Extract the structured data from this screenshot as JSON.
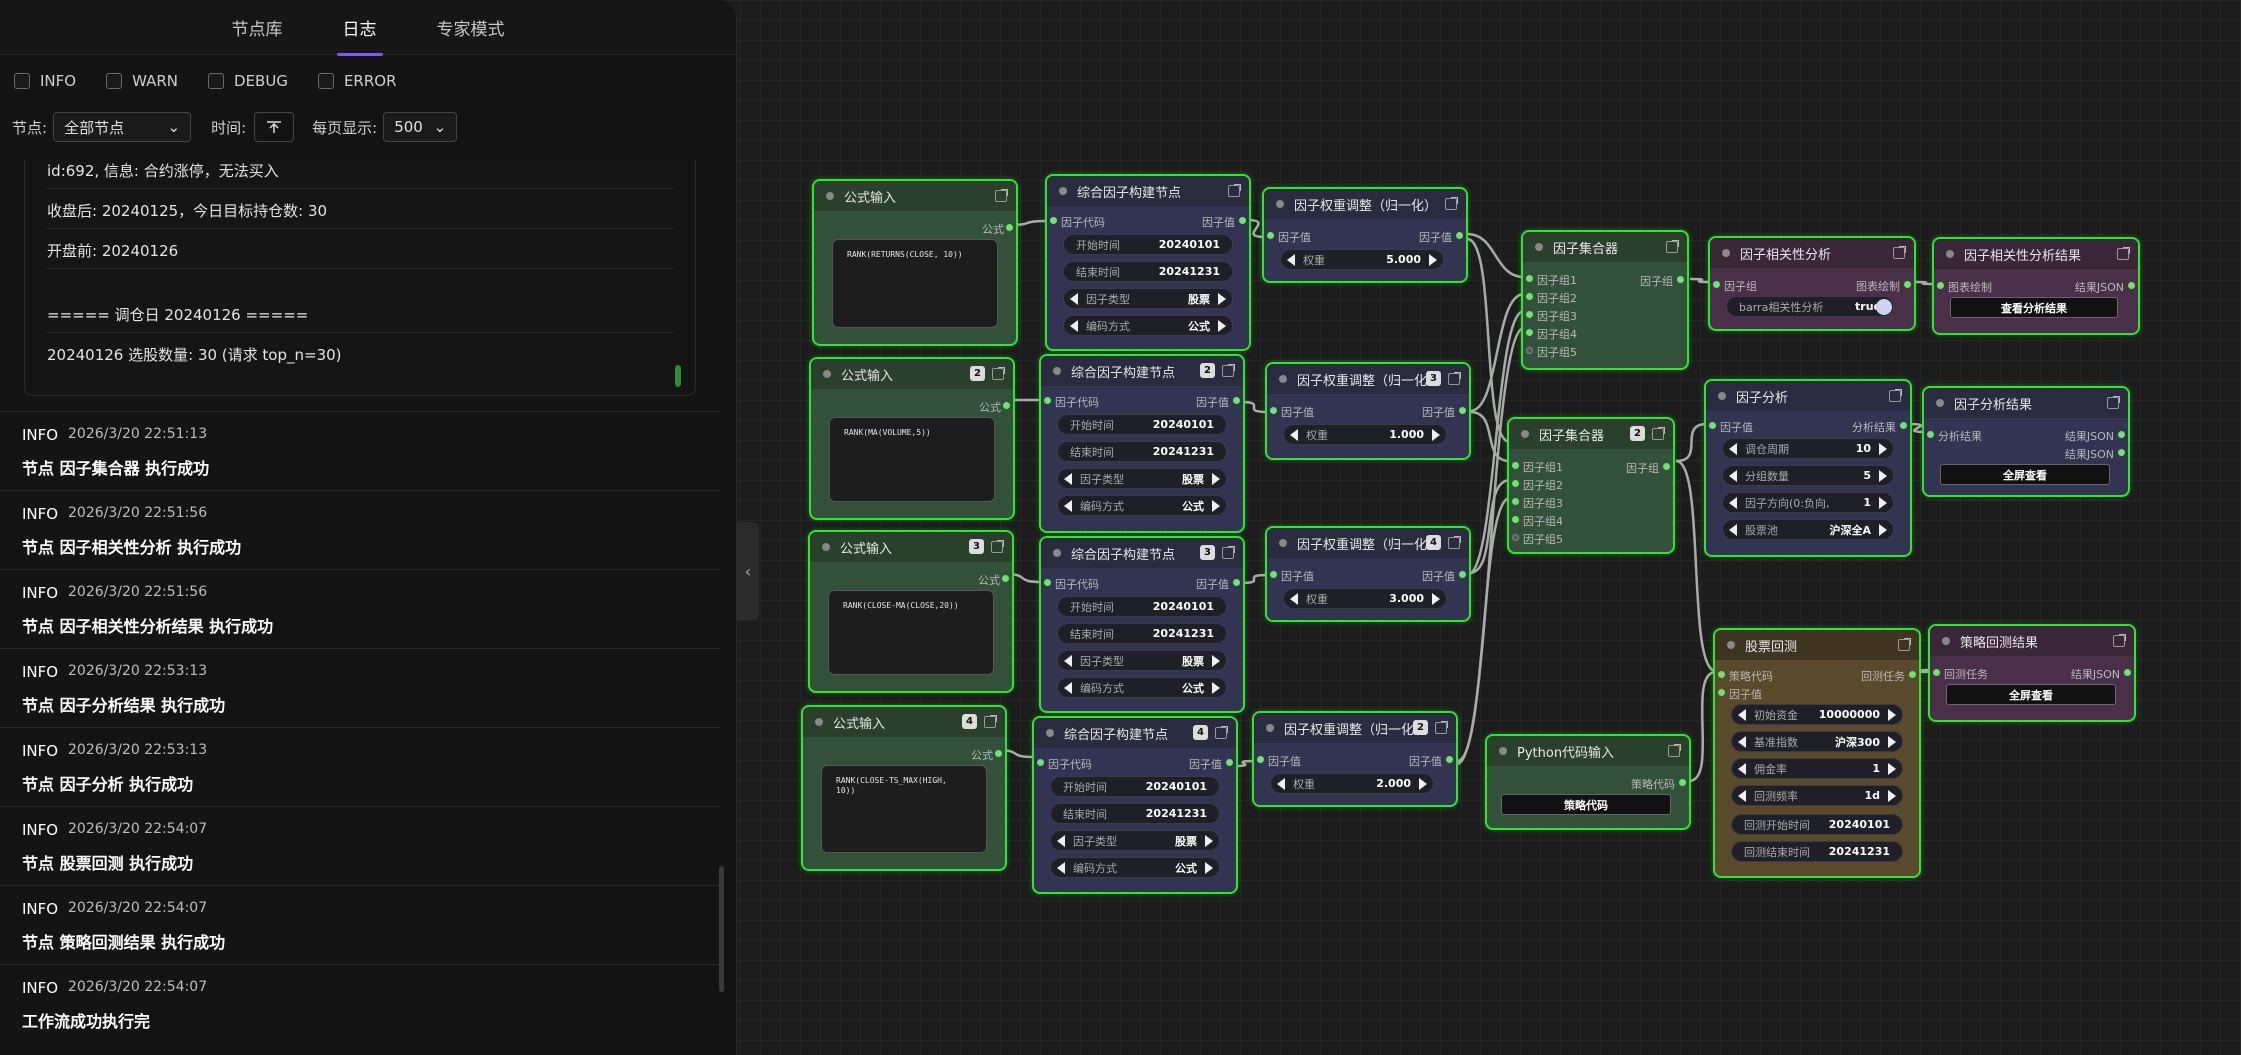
{
  "tabs": [
    "节点库",
    "日志",
    "专家模式"
  ],
  "filters": [
    "INFO",
    "WARN",
    "DEBUG",
    "ERROR"
  ],
  "controls": {
    "node_label": "节点:",
    "node_value": "全部节点",
    "time_label": "时间:",
    "page_label": "每页显示:",
    "page_value": "500"
  },
  "log_detail": [
    "id:692, 信息: 合约涨停，无法买入",
    "收盘后: 20240125，今日目标持仓数: 30",
    "开盘前: 20240126",
    "===== 调仓日 20240126 =====",
    "20240126 选股数量: 30 (请求 top_n=30)"
  ],
  "log_entries": [
    {
      "level": "INFO",
      "time": "2026/3/20 22:51:13",
      "msg": "节点 因子集合器 执行成功"
    },
    {
      "level": "INFO",
      "time": "2026/3/20 22:51:56",
      "msg": "节点 因子相关性分析 执行成功"
    },
    {
      "level": "INFO",
      "time": "2026/3/20 22:51:56",
      "msg": "节点 因子相关性分析结果 执行成功"
    },
    {
      "level": "INFO",
      "time": "2026/3/20 22:53:13",
      "msg": "节点 因子分析结果 执行成功"
    },
    {
      "level": "INFO",
      "time": "2026/3/20 22:53:13",
      "msg": "节点 因子分析 执行成功"
    },
    {
      "level": "INFO",
      "time": "2026/3/20 22:54:07",
      "msg": "节点 股票回测 执行成功"
    },
    {
      "level": "INFO",
      "time": "2026/3/20 22:54:07",
      "msg": "节点 策略回测结果 执行成功"
    },
    {
      "level": "INFO",
      "time": "2026/3/20 22:54:07",
      "msg": "工作流成功执行完"
    }
  ],
  "labels": {
    "formula_in": "公式输入",
    "formula": "公式",
    "builder": "综合因子构建节点",
    "factor_code": "因子代码",
    "factor_value": "因子值",
    "start_time": "开始时间",
    "end_time": "结束时间",
    "factor_type": "因子类型",
    "encoding": "编码方式",
    "weight_node": "因子权重调整（归一化）",
    "weight_node_short": "因子权重调整（归一化",
    "weight": "权重",
    "collector": "因子集合器",
    "group": "因子组",
    "corr": "因子相关性分析",
    "corr_out": "图表绘制",
    "barra": "barra相关性分析",
    "corr_result": "因子相关性分析结果",
    "chart_draw": "图表绘制",
    "result_json": "结果JSON",
    "view_corr": "查看分析结果",
    "analysis": "因子分析",
    "analysis_out": "分析结果",
    "period": "调仓周期",
    "groups": "分组数量",
    "direction": "因子方向(0:负向,",
    "pool": "股票池",
    "analysis_result": "因子分析结果",
    "fullscreen": "全屏查看",
    "py_input": "Python代码输入",
    "strategy_code": "策略代码",
    "backtest": "股票回测",
    "bt_task": "回测任务",
    "capital": "初始资金",
    "benchmark": "基准指数",
    "commission": "佣金率",
    "freq": "回测频率",
    "bt_start": "回测开始时间",
    "bt_end": "回测结束时间",
    "bt_result": "策略回测结果",
    "bt_task_in": "回测任务"
  },
  "formulas": [
    "RANK(RETURNS(CLOSE, 10))",
    "RANK(MA(VOLUME,5))",
    "RANK(CLOSE-MA(CLOSE,20))",
    "RANK(CLOSE-TS_MAX(HIGH,\n10))"
  ],
  "values": {
    "start": "20240101",
    "end": "20241231",
    "type": "股票",
    "enc": "公式",
    "weights": [
      "5.000",
      "1.000",
      "3.000",
      "2.000"
    ],
    "badges": [
      "2",
      "3",
      "4"
    ],
    "collector_badge": "2",
    "barra_val": "true",
    "period": "10",
    "groups": "5",
    "direction": "1",
    "pool": "沪深全A",
    "capital": "10000000",
    "benchmark": "沪深300",
    "commission": "1",
    "freq": "1d",
    "bt_start": "20240101",
    "bt_end": "20241231"
  },
  "colors": {
    "accent": "#7a5af8",
    "node_border": "#2ee62e"
  }
}
